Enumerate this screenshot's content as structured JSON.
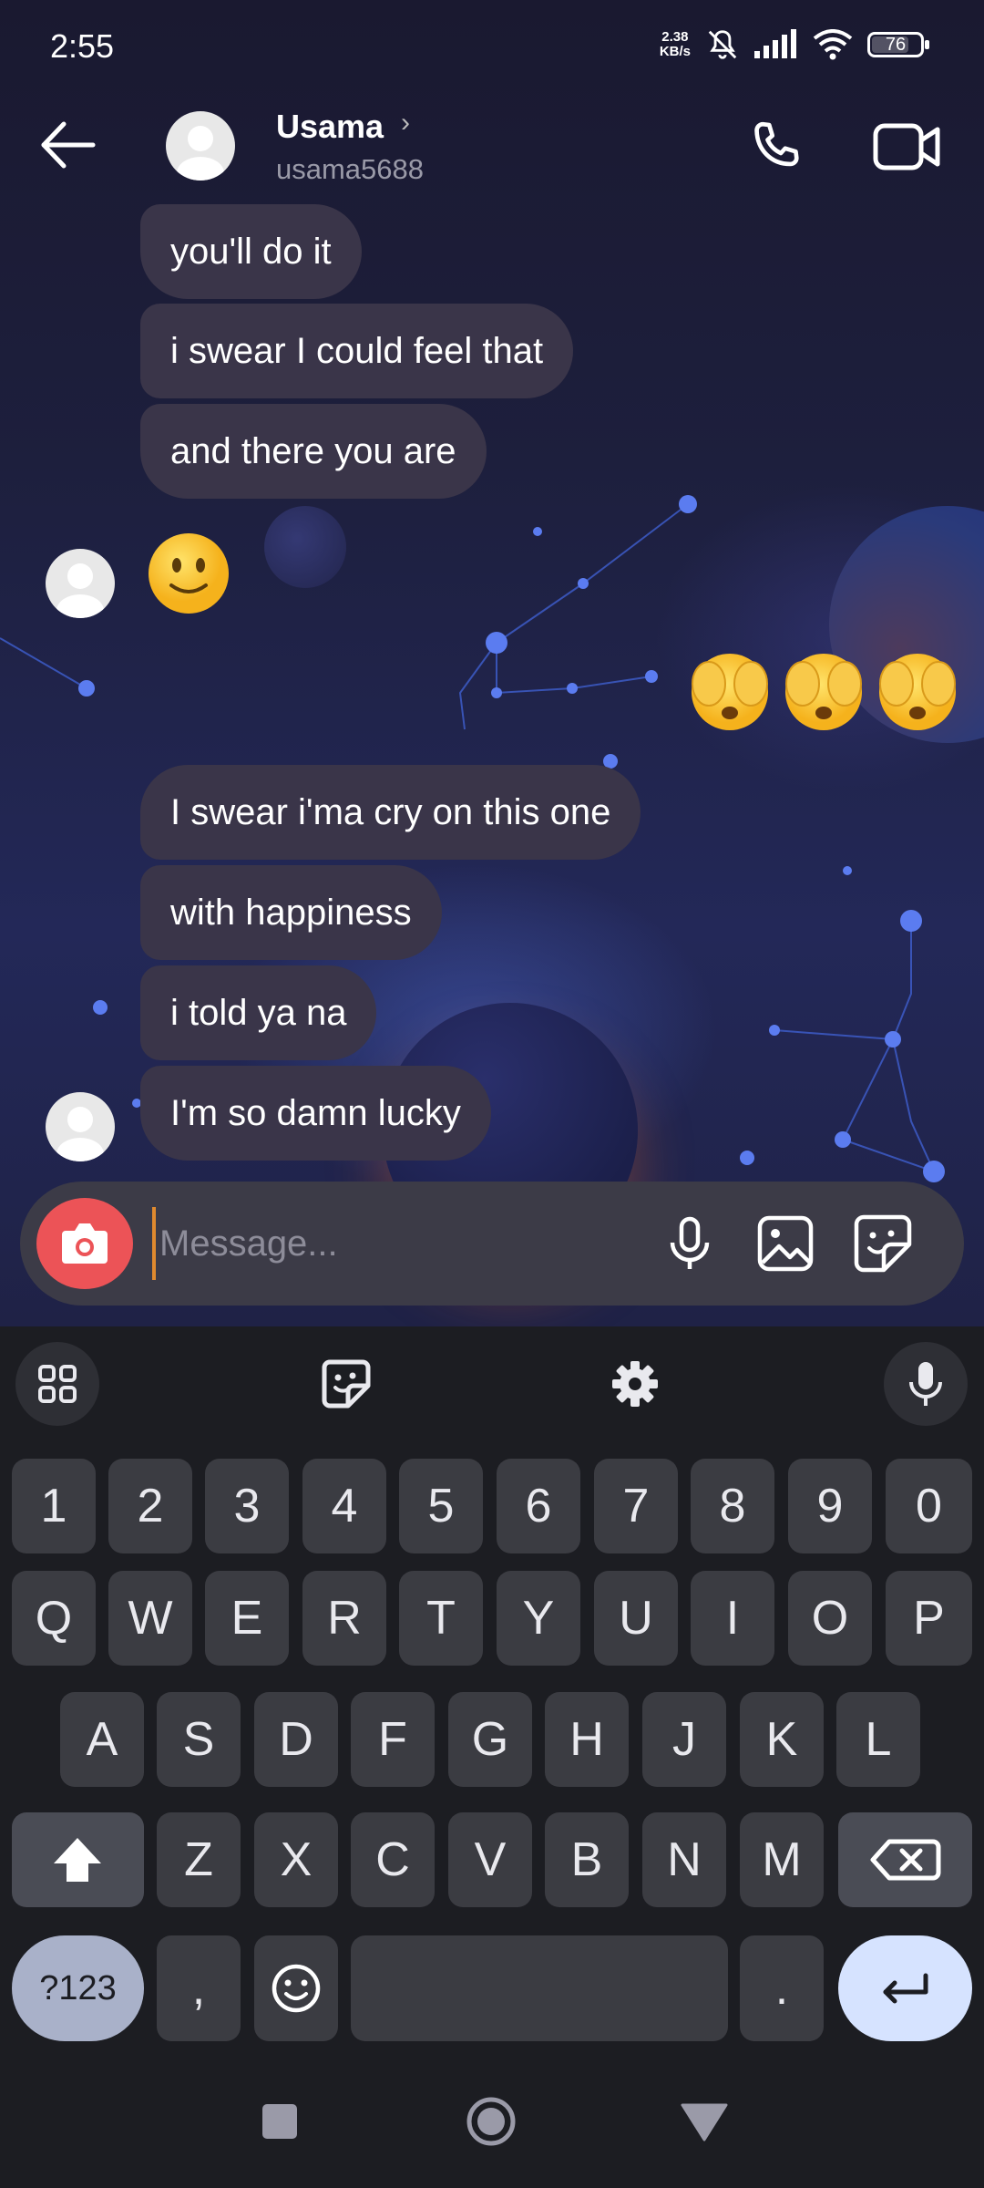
{
  "status_bar": {
    "time": "2:55",
    "net_speed_value": "2.38",
    "net_speed_unit": "KB/s",
    "battery": "76",
    "icons": [
      "mute-bell-icon",
      "signal-icon",
      "wifi-icon",
      "battery-icon"
    ]
  },
  "header": {
    "name": "Usama",
    "username": "usama5688",
    "icons": [
      "back-arrow-icon",
      "phone-icon",
      "video-camera-icon",
      "chevron-right-icon"
    ]
  },
  "messages": {
    "m1": "you'll do it",
    "m2": "i swear I could feel that",
    "m3": "and there you are",
    "emoji_in": "slightly-smiling-face",
    "emoji_out": [
      "face-with-hands-over-eyes",
      "face-with-hands-over-eyes",
      "face-with-hands-over-eyes"
    ],
    "m4": "I swear i'ma cry on this one",
    "m5": "with happiness",
    "m6": "i told ya na",
    "m7": "I'm so damn lucky"
  },
  "composer": {
    "placeholder": "Message...",
    "value": "",
    "icons": [
      "camera-icon",
      "microphone-icon",
      "image-icon",
      "sticker-icon"
    ]
  },
  "keyboard": {
    "toolbar_icons": [
      "apps-grid-icon",
      "sticker-icon",
      "settings-gear-icon",
      "microphone-icon"
    ],
    "row_numbers": [
      "1",
      "2",
      "3",
      "4",
      "5",
      "6",
      "7",
      "8",
      "9",
      "0"
    ],
    "row1": [
      "Q",
      "W",
      "E",
      "R",
      "T",
      "Y",
      "U",
      "I",
      "O",
      "P"
    ],
    "row2": [
      "A",
      "S",
      "D",
      "F",
      "G",
      "H",
      "J",
      "K",
      "L"
    ],
    "row3": [
      "Z",
      "X",
      "C",
      "V",
      "B",
      "N",
      "M"
    ],
    "symbols_key": "?123",
    "comma_key": ",",
    "period_key": "."
  },
  "nav_bar": {
    "icons": [
      "recents-square-icon",
      "home-circle-icon",
      "back-triangle-icon"
    ]
  },
  "colors": {
    "bubble": "#3a3549",
    "composer": "#3c3b47",
    "camera_button": "#ec5357",
    "enter_key": "#d6e3ff",
    "symbols_key": "#a9b1c9",
    "keyboard_bg": "#1c1d22",
    "key_bg": "#3b3c42"
  }
}
